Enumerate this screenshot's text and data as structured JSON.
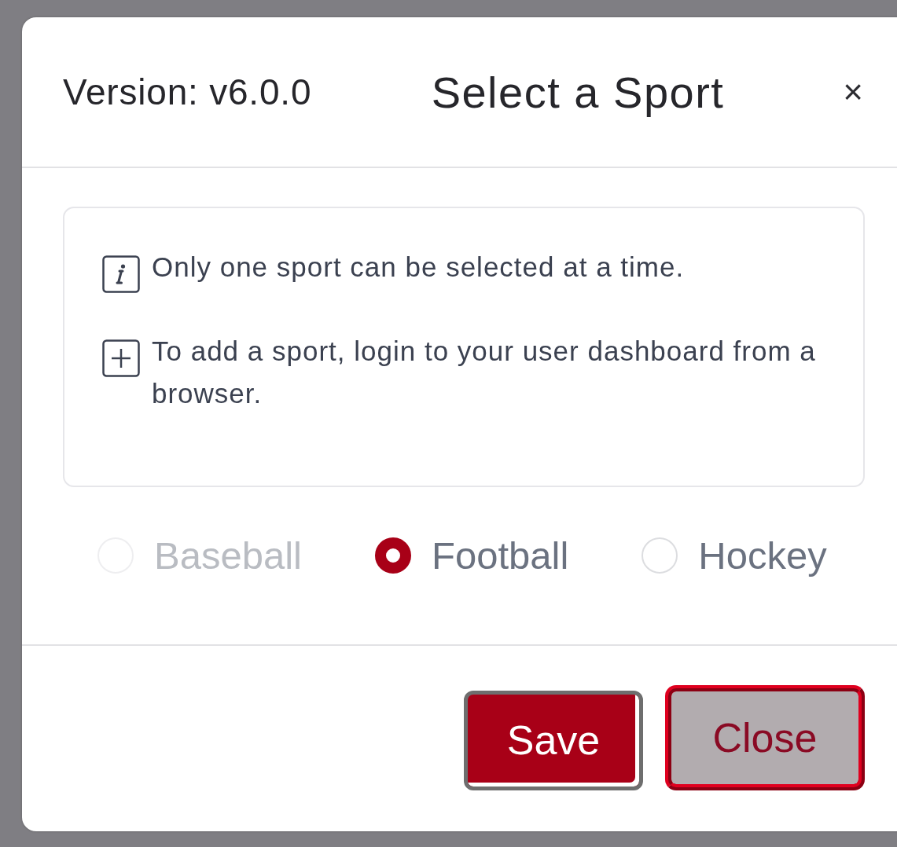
{
  "dialog": {
    "version": "Version: v6.0.0",
    "title": "Select a Sport",
    "close": "×"
  },
  "notes": [
    {
      "kind": "info",
      "text": "Only one sport can be selected at a time."
    },
    {
      "kind": "add",
      "text": "To add a sport, login to your user dashboard from a browser."
    }
  ],
  "sports": [
    {
      "label": "Baseball",
      "selected": false,
      "disabled": true
    },
    {
      "label": "Football",
      "selected": true,
      "disabled": false
    },
    {
      "label": "Hockey",
      "selected": false,
      "disabled": false
    }
  ],
  "buttons": [
    {
      "label": "Save",
      "kind": "primary"
    },
    {
      "label": "Close",
      "kind": "secondary"
    }
  ]
}
